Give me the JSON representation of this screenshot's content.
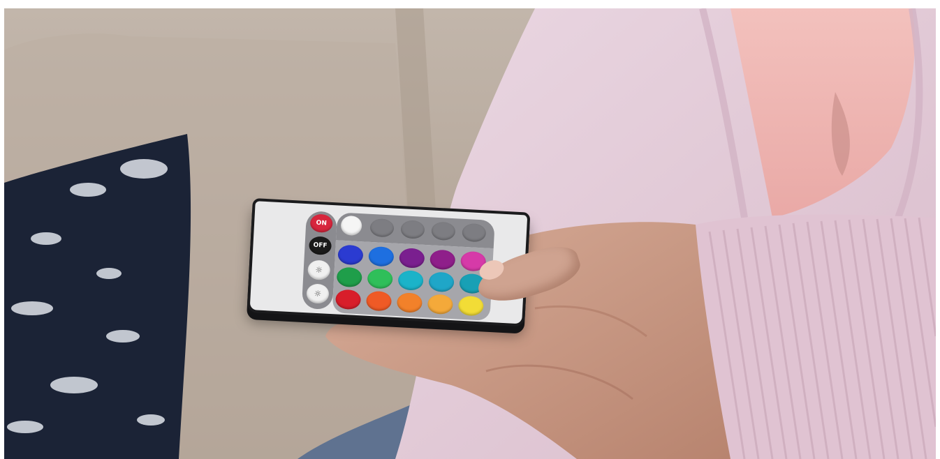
{
  "scene": {
    "subject": "hand-holding-rgb-remote",
    "colors": {
      "background_sofa": "#b9ab9d",
      "pillow": "#1a2133",
      "sweater": "#e6cfdc",
      "skin": "#c99a86",
      "remote_body": "#e9e9ea",
      "remote_edge": "#1b1b1d"
    }
  },
  "remote": {
    "buttons": {
      "on": {
        "label": "ON",
        "color": "#d7263d"
      },
      "off": {
        "label": "OFF",
        "color": "#1a1a1a"
      },
      "brightness_up": {
        "label": "",
        "color": "#f0f0f0"
      },
      "brightness_down": {
        "label": "",
        "color": "#f0f0f0"
      },
      "white": {
        "label": "",
        "color": "#f5f5f5"
      },
      "mode_buttons": [
        {
          "label": "",
          "color": "#7d7d82"
        },
        {
          "label": "",
          "color": "#7d7d82"
        },
        {
          "label": "",
          "color": "#7d7d82"
        },
        {
          "label": "",
          "color": "#7d7d82"
        }
      ],
      "color_rows": [
        [
          "#2b3bd1",
          "#1e6fe0",
          "#7a1f8f",
          "#8f1f8a",
          "#d63aa8"
        ],
        [
          "#1f9e4a",
          "#2fbf5a",
          "#1bb3c9",
          "#1fa6c8",
          "#18a0b5"
        ],
        [
          "#d81e2a",
          "#ef5a26",
          "#f2812a",
          "#f4a93a",
          "#f2dc36"
        ]
      ]
    }
  }
}
